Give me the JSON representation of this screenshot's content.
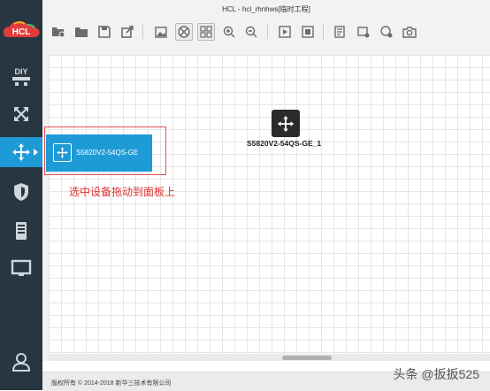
{
  "app": {
    "logo_text": "HCL",
    "window_title": "HCL - hcl_rhnhws[临时工程]"
  },
  "sidebar": {
    "items": [
      {
        "icon": "diy-icon",
        "label": "DIY"
      },
      {
        "icon": "crossed-arrows-icon"
      },
      {
        "icon": "move-arrows-icon",
        "active": true
      },
      {
        "icon": "shield-icon"
      },
      {
        "icon": "server-icon"
      },
      {
        "icon": "monitor-icon"
      },
      {
        "icon": "user-icon"
      }
    ]
  },
  "toolbar": {
    "buttons": [
      "open-project-icon",
      "open-folder-icon",
      "save-icon",
      "export-icon",
      "image-icon",
      "topology-icon",
      "grid-icon",
      "zoom-in-icon",
      "zoom-out-icon",
      "play-icon",
      "stop-icon",
      "notes-icon",
      "add-rect-icon",
      "add-ellipse-icon",
      "camera-icon"
    ]
  },
  "canvas": {
    "device_label": "S5820V2-54QS-GE_1"
  },
  "drag_popup": {
    "label": "S5820V2-54QS-GE"
  },
  "annotation": "选中设备拖动到面板上",
  "status": {
    "copyright": "版权所有 © 2014-2018 新华三技术有限公司"
  },
  "watermark": "头条 @扳扳525",
  "colors": {
    "sidebar_bg": "#273640",
    "accent": "#1e9bd6",
    "annotation": "#e03030"
  }
}
